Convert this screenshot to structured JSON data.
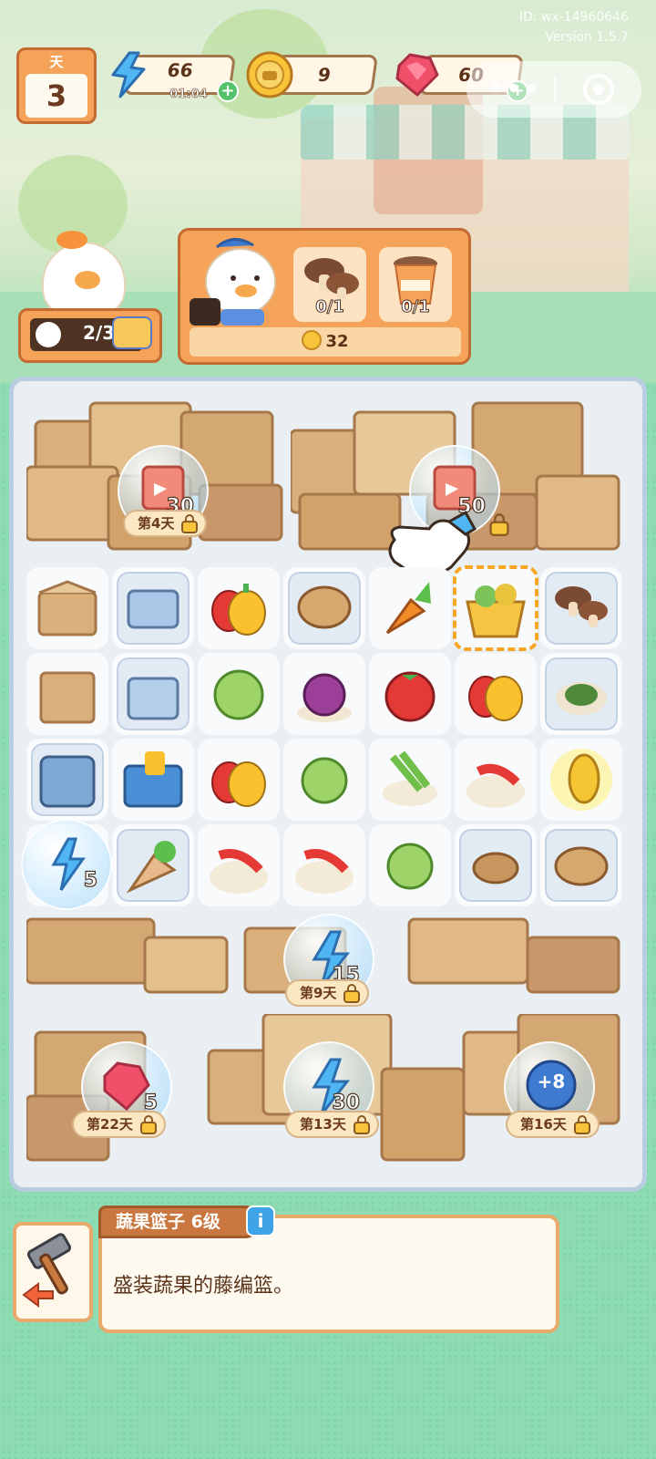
{
  "debug": {
    "id": "ID: wx-14960646",
    "version": "Version 1.5.7"
  },
  "day": {
    "label": "天",
    "value": "3"
  },
  "resources": {
    "energy": {
      "value": "66",
      "timer": "01:04"
    },
    "coins": {
      "value": "9"
    },
    "gems": {
      "value": "60"
    }
  },
  "chef": {
    "count": "2/3"
  },
  "order": {
    "items": [
      {
        "name": "mushroom",
        "count": "0/1"
      },
      {
        "name": "juice-cup",
        "count": "0/1"
      }
    ],
    "reward": "32"
  },
  "board": {
    "locked_chests": [
      {
        "reward_icon": "ticket-icon",
        "amount": "30",
        "unlock": "第4天"
      },
      {
        "reward_icon": "ticket-icon",
        "amount": "50",
        "unlock": ""
      },
      {
        "reward_icon": "energy-icon",
        "amount": "15",
        "unlock": "第9天"
      },
      {
        "reward_icon": "gem-icon",
        "amount": "5",
        "unlock": "第22天"
      },
      {
        "reward_icon": "energy-icon",
        "amount": "30",
        "unlock": "第13天"
      },
      {
        "reward_icon": "plus8-icon",
        "amount": "+8",
        "unlock": "第16天"
      }
    ],
    "energy_bubble": {
      "amount": "5"
    },
    "selected_item": "basket-with-corn"
  },
  "info": {
    "title": "蔬果篮子 6级",
    "description": "盛装蔬果的藤编篮。"
  },
  "colors": {
    "accent": "#f6a35a",
    "accent_dark": "#c46b33",
    "board_border": "#b8cde0",
    "background": "#8ddcb4"
  }
}
